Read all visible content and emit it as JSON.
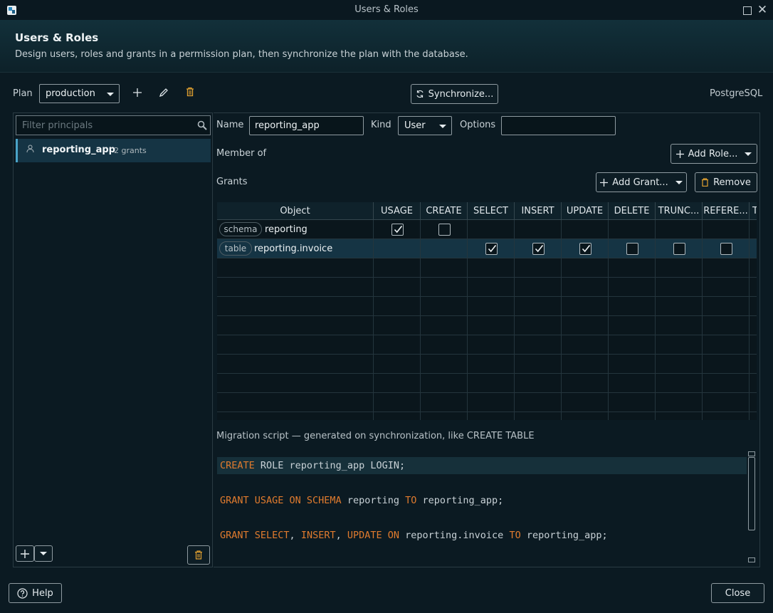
{
  "window": {
    "title": "Users & Roles"
  },
  "header": {
    "title": "Users & Roles",
    "description": "Design users, roles and grants in a permission plan, then synchronize the plan with the database."
  },
  "plan": {
    "label": "Plan",
    "selected": "production"
  },
  "toolbar": {
    "synchronize_label": "Synchronize...",
    "dialect": "PostgreSQL"
  },
  "principals": {
    "filter_placeholder": "Filter principals",
    "items": [
      {
        "name": "reporting_app",
        "grants": "2 grants"
      }
    ]
  },
  "editor": {
    "name_label": "Name",
    "name_value": "reporting_app",
    "kind_label": "Kind",
    "kind_value": "User",
    "options_label": "Options",
    "options_value": "",
    "member_of_label": "Member of",
    "add_role_label": "Add Role...",
    "grants_label": "Grants",
    "add_grant_label": "Add Grant...",
    "remove_label": "Remove"
  },
  "grants_table": {
    "columns": [
      "Object",
      "USAGE",
      "CREATE",
      "SELECT",
      "INSERT",
      "UPDATE",
      "DELETE",
      "TRUNC...",
      "REFERE...",
      "T"
    ],
    "rows": [
      {
        "type": "schema",
        "object": "reporting",
        "usage": true,
        "create": false
      },
      {
        "type": "table",
        "object": "reporting.invoice",
        "select": true,
        "insert": true,
        "update": true,
        "delete": false,
        "truncate": false,
        "references": false
      }
    ]
  },
  "script": {
    "label": "Migration script — generated on synchronization, like CREATE TABLE",
    "lines": [
      "CREATE ROLE reporting_app LOGIN;",
      "GRANT USAGE ON SCHEMA reporting TO reporting_app;",
      "GRANT SELECT, INSERT, UPDATE ON reporting.invoice TO reporting_app;"
    ],
    "tokens": {
      "l1_kw1": "CREATE",
      "l1_rest": " ROLE reporting_app LOGIN;",
      "l2_kw1": "GRANT USAGE ON SCHEMA",
      "l2_mid": " reporting ",
      "l2_kw2": "TO",
      "l2_rest": " reporting_app;",
      "l3_kw1": "GRANT SELECT",
      "l3_c1": ", ",
      "l3_kw2": "INSERT",
      "l3_c2": ", ",
      "l3_kw3": "UPDATE ON",
      "l3_mid": " reporting.invoice ",
      "l3_kw4": "TO",
      "l3_rest": " reporting_app;"
    }
  },
  "footer": {
    "help_label": "Help",
    "close_label": "Close"
  },
  "colors": {
    "accent": "#4aa3c7",
    "keyword": "#e07b2e",
    "background": "#0b1a22"
  }
}
